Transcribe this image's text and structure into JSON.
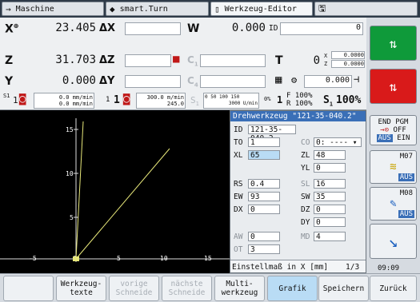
{
  "tabs": [
    {
      "label": "Maschine",
      "icon": "→"
    },
    {
      "label": "smart.Turn",
      "icon": "◆"
    },
    {
      "label": "Werkzeug-Editor",
      "icon": "▯"
    },
    {
      "label": "",
      "icon": "🖫"
    }
  ],
  "status": {
    "x_label": "X",
    "x_sup": "⊕",
    "x_value": "23.405",
    "dx_label": "ΔX",
    "z_label": "Z",
    "z_value": "31.703",
    "dz_label": "ΔZ",
    "y_label": "Y",
    "y_value": "0.000",
    "dy_label": "ΔY",
    "w_label": "W",
    "w_value": "0.000",
    "id_label": "ID",
    "id_value": "0",
    "c1_label": "C",
    "c1_sub": "1",
    "t_label": "T",
    "t_value": "0",
    "tx_label": "X",
    "tx_value": "0.0000",
    "tz_label": "Z",
    "tz_value": "0.0000",
    "c4_label": "C",
    "c4_sub": "4",
    "extra_value": "0.000",
    "s1_label": "S1",
    "s1_num": "1",
    "feed1": "0.0 mm/min",
    "feed2": "0.0 mm/min",
    "spindle_num": "1",
    "spindle_one": "1",
    "speed1": "300.0 m/min",
    "speed2": "245.0",
    "s_label": "S",
    "s_sub": "1",
    "rpm": "3000 U/min",
    "scale": "0  50 100 150",
    "pct_label": "0%",
    "f_label": "F",
    "f_pct": "100%",
    "r_label": "R",
    "r_pct": "100%",
    "s_pct_label": "S",
    "s_pct_sub": "1",
    "s_pct": "100%"
  },
  "sidebar": {
    "endpgm": "END PGM",
    "off": "OFF",
    "aus": "AUS",
    "ein": "EIN",
    "m07": "M07",
    "m07_aus": "AUS",
    "m08": "M08",
    "m08_aus": "AUS",
    "clock": "09:09"
  },
  "graph": {
    "y_ticks": [
      "15",
      "10",
      "5"
    ],
    "x_ticks": [
      "-5",
      "0",
      "5",
      "10",
      "15"
    ]
  },
  "dialog": {
    "title": "Drehwerkzeug \"121-35-040.2\"",
    "id_label": "ID",
    "id_value": "121-35-040.2",
    "to_label": "TO",
    "to_value": "1",
    "co_label": "CO",
    "co_value": "0: ---- ▾",
    "xl_label": "XL",
    "xl_value": "65",
    "zl_label": "ZL",
    "zl_value": "48",
    "yl_label": "YL",
    "yl_value": "0",
    "rs_label": "RS",
    "rs_value": "0.4",
    "sl_label": "SL",
    "sl_value": "16",
    "ew_label": "EW",
    "ew_value": "93",
    "sw_label": "SW",
    "sw_value": "35",
    "dx_label": "DX",
    "dx_value": "0",
    "dz_label": "DZ",
    "dz_value": "0",
    "dy_label": "DY",
    "dy_value": "0",
    "aw_label": "AW",
    "aw_value": "0",
    "md_label": "MD",
    "md_value": "4",
    "ot_label": "OT",
    "ot_value": "3",
    "hint": "Einstellmaß in X [mm]",
    "page": "1/3"
  },
  "softkeys": [
    {
      "label": "",
      "state": "normal"
    },
    {
      "label": "Werkzeug-\ntexte",
      "state": "normal"
    },
    {
      "label": "vorige\nSchneide",
      "state": "disabled"
    },
    {
      "label": "nächste\nSchneide",
      "state": "disabled"
    },
    {
      "label": "Multi-\nwerkzeug",
      "state": "normal"
    },
    {
      "label": "Grafik",
      "state": "highlight"
    },
    {
      "label": "Speichern",
      "state": "normal"
    },
    {
      "label": "Zurück",
      "state": "normal"
    }
  ]
}
